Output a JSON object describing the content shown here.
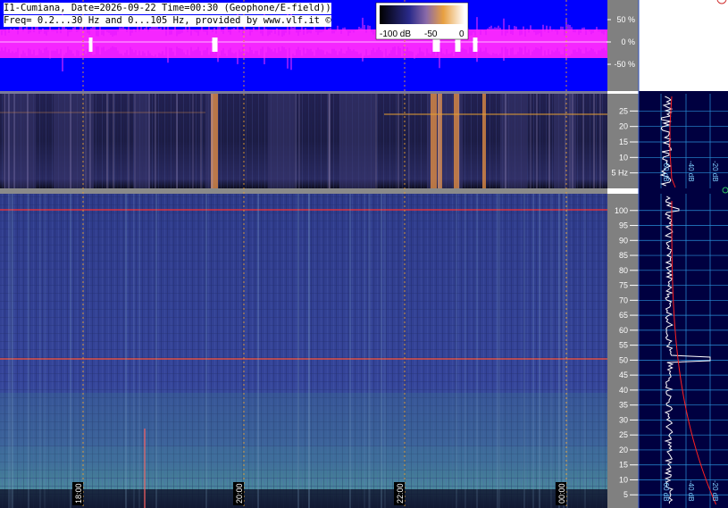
{
  "header": {
    "line1": "I1-Cumiana, Date=2026-09-22 Time=00:30 (Geophone/E-field))",
    "line2": "Freq= 0.2...30 Hz and 0...105 Hz, provided by www.vlf.it ©"
  },
  "colorbar": {
    "labels": [
      "-100 dB",
      "-50",
      "0"
    ]
  },
  "waveform_panel": {
    "percent_labels": [
      "50 %",
      "0 %",
      "-50 %"
    ]
  },
  "low_freq_panel": {
    "ticks": [
      "25",
      "20",
      "15",
      "10",
      "5 Hz"
    ],
    "db_labels": [
      "-60 dB",
      "-40 dB",
      "-20 dB"
    ]
  },
  "high_freq_panel": {
    "ticks": [
      "100",
      "95",
      "90",
      "85",
      "80",
      "75",
      "70",
      "65",
      "60",
      "55",
      "50",
      "45",
      "40",
      "35",
      "30",
      "25",
      "20",
      "15",
      "10",
      "5"
    ],
    "db_labels": [
      "-60 dB",
      "-40 dB",
      "-20 dB"
    ]
  },
  "time_axis": {
    "labels": [
      "18:00",
      "20:00",
      "22:00",
      "00:00"
    ]
  },
  "colors": {
    "waveform_bg": "#0000ff",
    "waveform_trace": "#ff20ff",
    "spectro_dark": "#1a1a40",
    "spectro_mid": "#34408a",
    "marker_line": "#e8a030",
    "side_bg": "#000040",
    "grid_cyan": "#2a8fd8"
  }
}
